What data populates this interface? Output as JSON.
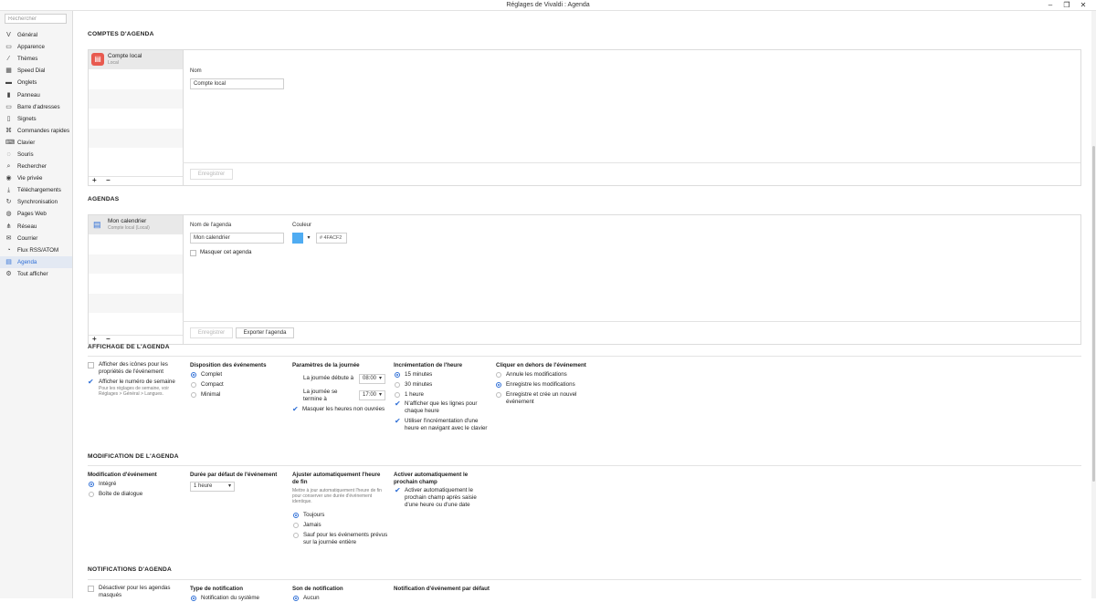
{
  "window": {
    "title": "Réglages de Vivaldi : Agenda"
  },
  "sidebar": {
    "search_placeholder": "Rechercher",
    "items": [
      {
        "label": "Général",
        "icon": "v-icon"
      },
      {
        "label": "Apparence",
        "icon": "appearance-icon"
      },
      {
        "label": "Thèmes",
        "icon": "brush-icon"
      },
      {
        "label": "Speed Dial",
        "icon": "grid-icon"
      },
      {
        "label": "Onglets",
        "icon": "tabs-icon"
      },
      {
        "label": "Panneau",
        "icon": "panel-icon"
      },
      {
        "label": "Barre d'adresses",
        "icon": "address-bar-icon"
      },
      {
        "label": "Signets",
        "icon": "bookmark-icon"
      },
      {
        "label": "Commandes rapides",
        "icon": "quick-commands-icon"
      },
      {
        "label": "Clavier",
        "icon": "keyboard-icon"
      },
      {
        "label": "Souris",
        "icon": "mouse-icon"
      },
      {
        "label": "Rechercher",
        "icon": "search-icon"
      },
      {
        "label": "Vie privée",
        "icon": "eye-icon"
      },
      {
        "label": "Téléchargements",
        "icon": "download-icon"
      },
      {
        "label": "Synchronisation",
        "icon": "sync-icon"
      },
      {
        "label": "Pages Web",
        "icon": "globe-icon"
      },
      {
        "label": "Réseau",
        "icon": "network-icon"
      },
      {
        "label": "Courrier",
        "icon": "mail-icon"
      },
      {
        "label": "Flux RSS/ATOM",
        "icon": "rss-icon"
      },
      {
        "label": "Agenda",
        "icon": "calendar-icon"
      },
      {
        "label": "Tout afficher",
        "icon": "gear-icon"
      }
    ]
  },
  "accounts": {
    "heading": "COMPTES D'AGENDA",
    "item_title": "Compte local",
    "item_sub": "Local",
    "name_label": "Nom",
    "name_value": "Compte local",
    "save": "Enregistrer",
    "add": "+",
    "remove": "−"
  },
  "calendars": {
    "heading": "AGENDAS",
    "item_title": "Mon calendrier",
    "item_sub": "Compte local (Local)",
    "name_label": "Nom de l'agenda",
    "name_value": "Mon calendrier",
    "color_label": "Couleur",
    "color_hash": "#",
    "color_hex": "4FACF2",
    "hide_label": "Masquer cet agenda",
    "save": "Enregistrer",
    "export": "Exporter l'agenda",
    "add": "+",
    "remove": "−",
    "swatch_color": "#4FACF2"
  },
  "display": {
    "heading": "AFFICHAGE DE L'AGENDA",
    "show_icons": "Afficher des icônes pour les propriétés de l'événement",
    "show_week": "Afficher le numéro de semaine",
    "week_help": "Pour les réglages de semaine, voir Réglages > Général > Langues.",
    "layout_title": "Disposition des événements",
    "layout_options": [
      "Complet",
      "Compact",
      "Minimal"
    ],
    "day_title": "Paramètres de la journée",
    "day_start_label": "La journée débute à",
    "day_start_value": "08:00",
    "day_end_label": "La journée se termine à",
    "day_end_value": "17:00",
    "hide_nonwork": "Masquer les heures non ouvrées",
    "inc_title": "Incrémentation de l'heure",
    "inc_options": [
      "15 minutes",
      "30 minutes",
      "1 heure"
    ],
    "inc_lines": "N'afficher que les lignes pour chaque heure",
    "inc_keyboard": "Utiliser l'incrémentation d'une heure en navigant avec le clavier",
    "click_title": "Cliquer en dehors de l'événement",
    "click_options": [
      "Annule les modifications",
      "Enregistre les modifications",
      "Enregistre et crée un nouvel événement"
    ]
  },
  "edit": {
    "heading": "MODIFICATION DE L'AGENDA",
    "mod_title": "Modification d'événement",
    "mod_options": [
      "Intégré",
      "Boîte de dialogue"
    ],
    "dur_title": "Durée par défaut de l'événement",
    "dur_value": "1 heure",
    "auto_end_title": "Ajuster automatiquement l'heure de fin",
    "auto_end_help": "Mettre à jour automatiquement l'heure de fin pour conserver une durée d'événement identique.",
    "auto_end_options": [
      "Toujours",
      "Jamais",
      "Sauf pour les événements prévus sur la journée entière"
    ],
    "next_title": "Activer automatiquement le prochain champ",
    "next_check": "Activer automatiquement le prochain champ après saisie d'une heure ou d'une date"
  },
  "notif": {
    "heading": "NOTIFICATIONS D'AGENDA",
    "disable_hidden": "Désactiver pour les agendas masqués",
    "type_title": "Type de notification",
    "type_first": "Notification du système",
    "sound_title": "Son de notification",
    "sound_first": "Aucun",
    "default_title": "Notification d'événement par défaut"
  }
}
